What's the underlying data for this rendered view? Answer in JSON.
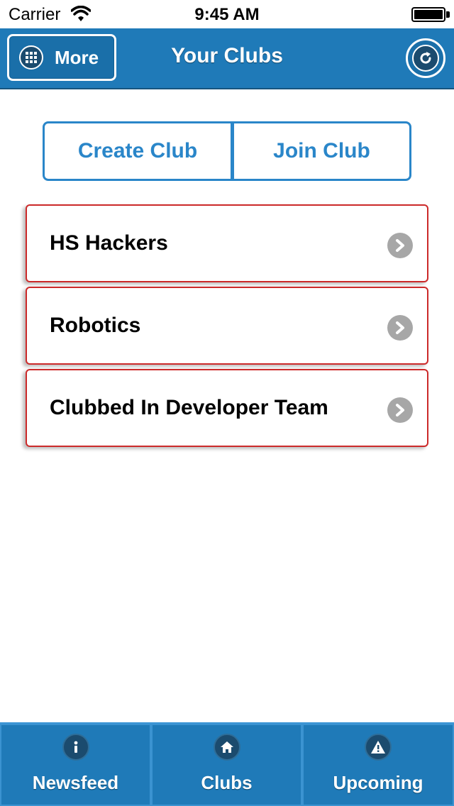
{
  "status_bar": {
    "carrier": "Carrier",
    "time": "9:45 AM"
  },
  "nav": {
    "more_label": "More",
    "title": "Your Clubs"
  },
  "actions": {
    "create_label": "Create Club",
    "join_label": "Join Club"
  },
  "clubs": [
    {
      "name": "HS Hackers"
    },
    {
      "name": "Robotics"
    },
    {
      "name": "Clubbed In Developer Team"
    }
  ],
  "tabs": [
    {
      "label": "Newsfeed",
      "icon": "info-icon"
    },
    {
      "label": "Clubs",
      "icon": "home-icon"
    },
    {
      "label": "Upcoming",
      "icon": "warning-icon"
    }
  ],
  "colors": {
    "primary": "#1f7ab8",
    "accent": "#2a86c9",
    "item_border": "#cc2a2a"
  }
}
